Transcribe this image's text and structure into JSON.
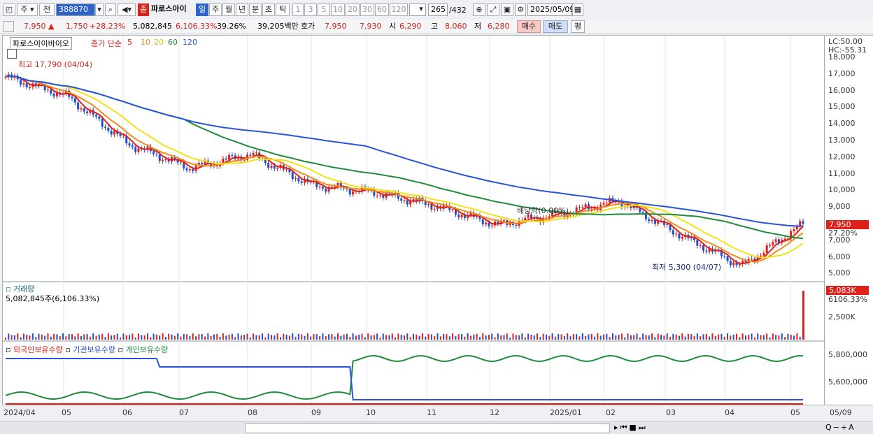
{
  "toolbar": {
    "market_btn": "주",
    "prev_btn": "전",
    "code": "388870",
    "stock_badge": "종",
    "stock_name": "파로스아이",
    "periods": [
      "일",
      "주",
      "월",
      "년",
      "분",
      "초",
      "틱"
    ],
    "intervals": [
      "1",
      "3",
      "5",
      "10",
      "20",
      "30",
      "60",
      "120"
    ],
    "count": "265",
    "total": "/432",
    "date": "2025/05/09"
  },
  "quote": {
    "price": "7,950",
    "arrow": "▲",
    "change": "1,750",
    "change_pct": "+28.23%",
    "volume": "5,082,845",
    "volume_pct": "6,106.33%",
    "turnover_pct": "39.26%",
    "amount": "39,205백만",
    "bid_label": "호가",
    "bid_sell": "7,950",
    "bid_buy": "7,930",
    "open_label": "시",
    "open": "6,290",
    "high_label": "고",
    "high": "8,060",
    "low_label": "저",
    "low": "6,280",
    "buy_btn": "매수",
    "sell_btn": "매도",
    "eval_btn": "평"
  },
  "price_panel": {
    "legend_title": "파로스아이바이오",
    "legend_ma_label": "종가 단순",
    "ma_periods": [
      "5",
      "10",
      "20",
      "60",
      "120"
    ],
    "ma_colors": [
      "#e0201a",
      "#f08c1a",
      "#f2e21a",
      "#1e8c3a",
      "#2a55d8"
    ],
    "max_label": "최고 17,790 (04/04)",
    "min_label": "최저 5,300 (04/07)",
    "dividend_label": "배당락(0.00%)",
    "lc": "LC:50.00",
    "hc": "HC:-55.31",
    "price_ticks": [
      "18,000",
      "17,000",
      "16,000",
      "15,000",
      "14,000",
      "13,000",
      "12,000",
      "11,000",
      "10,000",
      "9,000",
      "8,000",
      "7,000",
      "6,000",
      "5,000"
    ],
    "last_price": "7,950",
    "last_pct": "27.20%"
  },
  "volume_panel": {
    "title": "거래량",
    "value": "5,082,845주(6,106.33%)",
    "last": "5,083K",
    "last_pct": "6106.33%",
    "tick": "2,500K"
  },
  "holdings_panel": {
    "legends": [
      "외국인보유수량",
      "기관보유수량",
      "개인보유수량"
    ],
    "colors": [
      "#e0201a",
      "#2a55d8",
      "#1e8c3a"
    ],
    "ticks": [
      "5,800,000",
      "5,600,000"
    ]
  },
  "x_labels": [
    "2024/04",
    "05",
    "06",
    "07",
    "08",
    "09",
    "10",
    "11",
    "12",
    "2025/01",
    "02",
    "03",
    "04",
    "05"
  ],
  "x_right_label": "05/09",
  "chart_data": {
    "type": "line",
    "ylabel": "",
    "ylim": [
      5000,
      18500
    ],
    "series": [
      {
        "name": "",
        "x": [
          "2024/04",
          "2024/05",
          "2024/06",
          "2024/07",
          "2024/08",
          "2024/09",
          "2024/10",
          "2024/11",
          "2024/12",
          "2025/01",
          "2025/02",
          "2025/03",
          "2025/04",
          "2025/05"
        ],
        "values": [
          16500,
          15400,
          12600,
          11200,
          12000,
          10200,
          9800,
          9000,
          7900,
          8500,
          9300,
          7300,
          5500,
          7950
        ]
      }
    ]
  }
}
